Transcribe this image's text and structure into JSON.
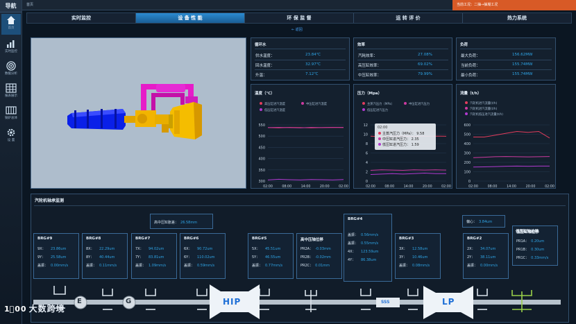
{
  "sidebar": {
    "title": "导航",
    "items": [
      {
        "label": "首页",
        "icon": "home-icon"
      },
      {
        "label": "实时监控",
        "icon": "bar-chart-icon"
      },
      {
        "label": "数据分析",
        "icon": "target-icon"
      },
      {
        "label": "报表展示",
        "icon": "table-icon"
      },
      {
        "label": "锅炉总体",
        "icon": "grid-icon"
      },
      {
        "label": "设 置",
        "icon": "gear-icon"
      }
    ]
  },
  "topbar": {
    "caption": "首页",
    "alert": "当前工况：二抽→抽凝工况"
  },
  "tabs": [
    "实时监控",
    "设 备 性 能",
    "环 保 监 督",
    "运 转 评 价",
    "热力系统"
  ],
  "back_link": "← 返回",
  "circulating_water": {
    "title": "循环水",
    "rows": [
      {
        "label": "供水温度：",
        "value": "23.84℃"
      },
      {
        "label": "回水温度：",
        "value": "32.97℃"
      },
      {
        "label": "升温：",
        "value": "7.12℃"
      }
    ]
  },
  "efficiency": {
    "title": "效率",
    "rows": [
      {
        "label": "汽耗效率：",
        "value": "27.08%"
      },
      {
        "label": "高压缸效率：",
        "value": "69.02%"
      },
      {
        "label": "中压缸效率：",
        "value": "79.99%"
      }
    ]
  },
  "load": {
    "title": "负荷",
    "rows": [
      {
        "label": "最大负荷：",
        "value": "156.62MW"
      },
      {
        "label": "当前负荷：",
        "value": "155.74MW"
      },
      {
        "label": "最小负荷：",
        "value": "155.74MW"
      }
    ]
  },
  "chart_data": [
    {
      "type": "line",
      "title": "温度（℃）",
      "categories": [
        "02:00",
        "08:00",
        "14:00",
        "20:00",
        "02:00"
      ],
      "ylim": [
        300,
        550
      ],
      "yticks": [
        550,
        500,
        450,
        400,
        350,
        300
      ],
      "series": [
        {
          "name": "高压缸进汽温度",
          "color": "#e23c5c",
          "values": [
            538,
            537,
            539,
            538,
            537,
            538,
            539,
            538
          ]
        },
        {
          "name": "中压缸进汽温度",
          "color": "#cc3aa0",
          "values": [
            538,
            539,
            538,
            537,
            539,
            538,
            539,
            539
          ]
        },
        {
          "name": "低压缸进汽温度",
          "color": "#b03ad0",
          "values": [
            305,
            308,
            306,
            305,
            307,
            306,
            305,
            307
          ]
        }
      ],
      "grid": true,
      "legend": "top"
    },
    {
      "type": "line",
      "title": "压力（Mpa）",
      "categories": [
        "02:00",
        "08:00",
        "14:00",
        "20:00",
        "02:00"
      ],
      "ylim": [
        0,
        12
      ],
      "yticks": [
        12,
        10,
        8,
        6,
        4,
        2,
        0
      ],
      "series": [
        {
          "name": "主蒸汽压力（MPa）",
          "color": "#e23c5c",
          "values": [
            9.6,
            9.5,
            9.6,
            9.6,
            9.5,
            9.6,
            9.6,
            9.58
          ]
        },
        {
          "name": "中压缸进汽压力",
          "color": "#cc3aa0",
          "values": [
            2.3,
            2.4,
            2.35,
            2.3,
            2.4,
            2.35,
            2.4,
            2.35
          ]
        },
        {
          "name": "低压缸进汽压力",
          "color": "#b03ad0",
          "values": [
            1.4,
            1.5,
            1.6,
            1.5,
            1.6,
            1.7,
            1.6,
            1.59
          ]
        }
      ],
      "tooltip": {
        "time": "02:00",
        "rows": [
          {
            "label": "主蒸汽压力（MPa）：",
            "value": "9.58"
          },
          {
            "label": "中压缸进汽压力：",
            "value": "2.35"
          },
          {
            "label": "低压缸进汽压力：",
            "value": "1.59"
          }
        ]
      },
      "grid": true,
      "legend": "top"
    },
    {
      "type": "line",
      "title": "流量（t/h）",
      "categories": [
        "02:00",
        "08:00",
        "14:00",
        "20:00",
        "02:00"
      ],
      "ylim": [
        0,
        600
      ],
      "yticks": [
        600,
        500,
        400,
        300,
        200,
        100,
        0
      ],
      "series": [
        {
          "name": "汽轮机进汽流量(t/h)",
          "color": "#e23c5c",
          "values": [
            470,
            470,
            490,
            510,
            530,
            520,
            530,
            460
          ]
        },
        {
          "name": "汽轮机进汽流量(t/h)",
          "color": "#cc3aa0",
          "values": [
            250,
            255,
            260,
            262,
            260,
            258,
            260,
            262
          ]
        },
        {
          "name": "汽轮机低压进汽流量(t/h)",
          "color": "#b03ad0",
          "values": [
            150,
            152,
            155,
            158,
            160,
            158,
            160,
            160
          ]
        }
      ],
      "grid": true,
      "legend": "top"
    }
  ],
  "bearing_section": {
    "title": "汽轮机轴承监测",
    "hp_expansion": {
      "label": "高中压缸胀差：",
      "value": "26.58mm"
    },
    "eccentricity": {
      "label": "偏心：",
      "value": "3.84um"
    },
    "lp_expansion": {
      "title": "低压缸轴位移"
    },
    "boxes": [
      {
        "title": "BRG#9",
        "rows": [
          {
            "label": "9X：",
            "value": "23.86um"
          },
          {
            "label": "9Y：",
            "value": "25.58um"
          },
          {
            "label": "盖振：",
            "value": "0.00mm/s"
          }
        ]
      },
      {
        "title": "BRG#8",
        "rows": [
          {
            "label": "8X：",
            "value": "22.29um"
          },
          {
            "label": "8Y：",
            "value": "40.44um"
          },
          {
            "label": "盖振：",
            "value": "0.11mm/s"
          }
        ]
      },
      {
        "title": "BRG#7",
        "rows": [
          {
            "label": "7X：",
            "value": "94.02um"
          },
          {
            "label": "7Y：",
            "value": "83.81um"
          },
          {
            "label": "盖振：",
            "value": "1.09mm/s"
          }
        ]
      },
      {
        "title": "BRG#6",
        "rows": [
          {
            "label": "6X：",
            "value": "90.72um"
          },
          {
            "label": "6Y：",
            "value": "110.02um"
          },
          {
            "label": "盖振：",
            "value": "0.59mm/s"
          }
        ]
      },
      {
        "title": "BRG#5",
        "rows": [
          {
            "label": "5X：",
            "value": "45.51um"
          },
          {
            "label": "5Y：",
            "value": "46.55um"
          },
          {
            "label": "盖振：",
            "value": "0.77mm/s"
          }
        ]
      },
      {
        "title": "高中压轴位移",
        "rows": [
          {
            "label": "PR2A：",
            "value": "-0.03mm"
          },
          {
            "label": "PR2B：",
            "value": "-0.02mm"
          },
          {
            "label": "PR2C：",
            "value": "0.01mm"
          }
        ]
      },
      {
        "title": "BRG#4",
        "rows": [
          {
            "label": "盖振：",
            "value": "0.56mm/s"
          },
          {
            "label": "盖振：",
            "value": "0.55mm/s"
          },
          {
            "label": "4X：",
            "value": "123.59um"
          },
          {
            "label": "4Y：",
            "value": "86.38um"
          }
        ]
      },
      {
        "title": "BRG#3",
        "rows": [
          {
            "label": "3X：",
            "value": "12.58um"
          },
          {
            "label": "3Y：",
            "value": "10.46um"
          },
          {
            "label": "盖振：",
            "value": "0.08mm/s"
          }
        ]
      },
      {
        "title": "BRG#2",
        "rows": [
          {
            "label": "2X：",
            "value": "34.07um"
          },
          {
            "label": "2Y：",
            "value": "38.11um"
          },
          {
            "label": "盖振：",
            "value": "0.00mm/s"
          }
        ]
      },
      {
        "title": "低压缸轴位移",
        "rows": [
          {
            "label": "PR1A：",
            "value": "0.20um"
          },
          {
            "label": "PR1B：",
            "value": "0.30um"
          },
          {
            "label": "PR1C：",
            "value": "0.33mm/s"
          }
        ]
      }
    ]
  },
  "shaft": {
    "labels": [
      "E",
      "G",
      "HIP",
      "SSS",
      "LP"
    ]
  },
  "watermark": {
    "logo": "1⃝00",
    "text": "大数跨境"
  }
}
